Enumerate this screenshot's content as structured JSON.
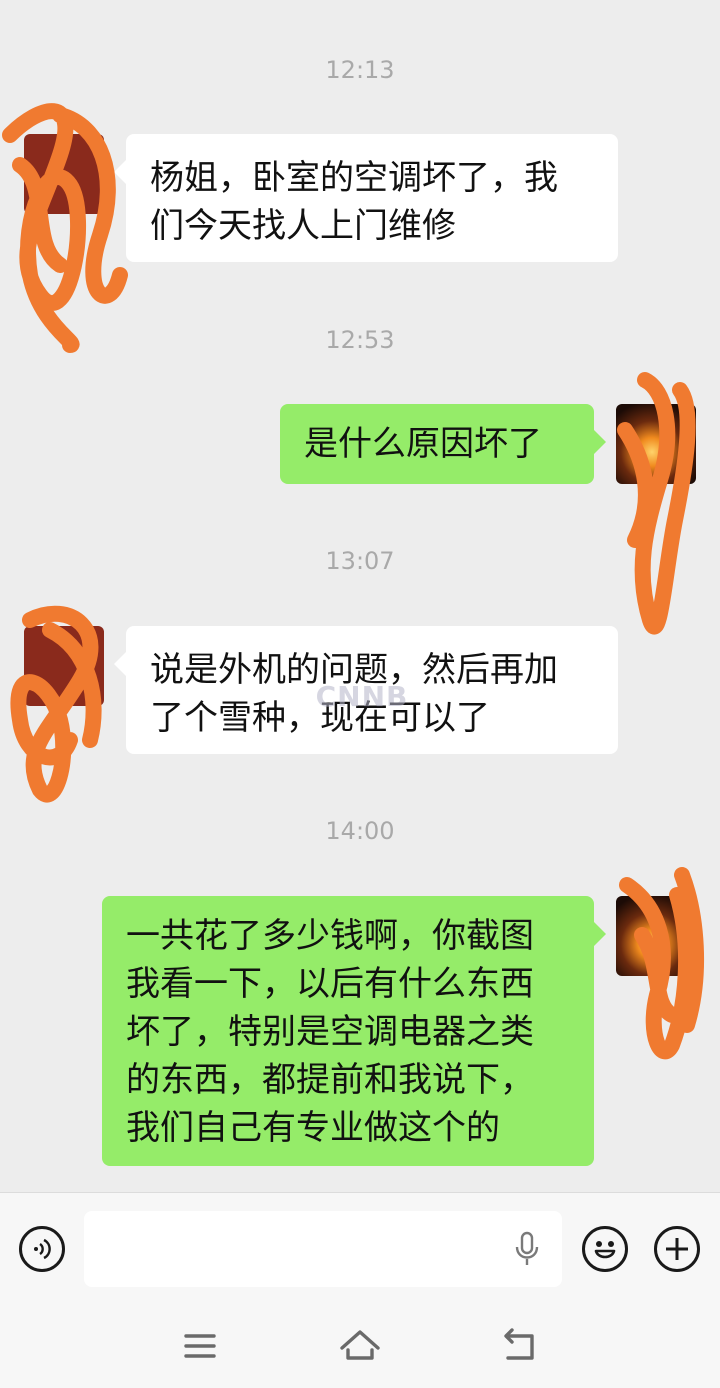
{
  "messages": [
    {
      "type": "time",
      "text": "12:13"
    },
    {
      "type": "in",
      "text": "杨姐，卧室的空调坏了，我\n们今天找人上门维修"
    },
    {
      "type": "time",
      "text": "12:53"
    },
    {
      "type": "out",
      "text": "是什么原因坏了"
    },
    {
      "type": "time",
      "text": "13:07"
    },
    {
      "type": "in",
      "text": "说是外机的问题，然后再加\n了个雪种，现在可以了"
    },
    {
      "type": "time",
      "text": "14:00"
    },
    {
      "type": "out",
      "text": "一共花了多少钱啊，你截图\n我看一下，以后有什么东西\n坏了，特别是空调电器之类\n的东西，都提前和我说下，\n我们自己有专业做这个的"
    }
  ],
  "watermark": "CNNB",
  "input_bar": {
    "voice_icon": "voice-icon",
    "mic_icon": "mic-icon",
    "emoji_icon": "emoji-icon",
    "plus_icon": "plus-icon"
  },
  "nav_bar": {
    "menu_icon": "menu-icon",
    "home_icon": "home-icon",
    "back_icon": "back-icon"
  },
  "colors": {
    "background": "#ededed",
    "incoming_bubble": "#ffffff",
    "outgoing_bubble": "#95ec69",
    "timestamp": "#a9a9a9",
    "scribble": "#f07a30"
  }
}
